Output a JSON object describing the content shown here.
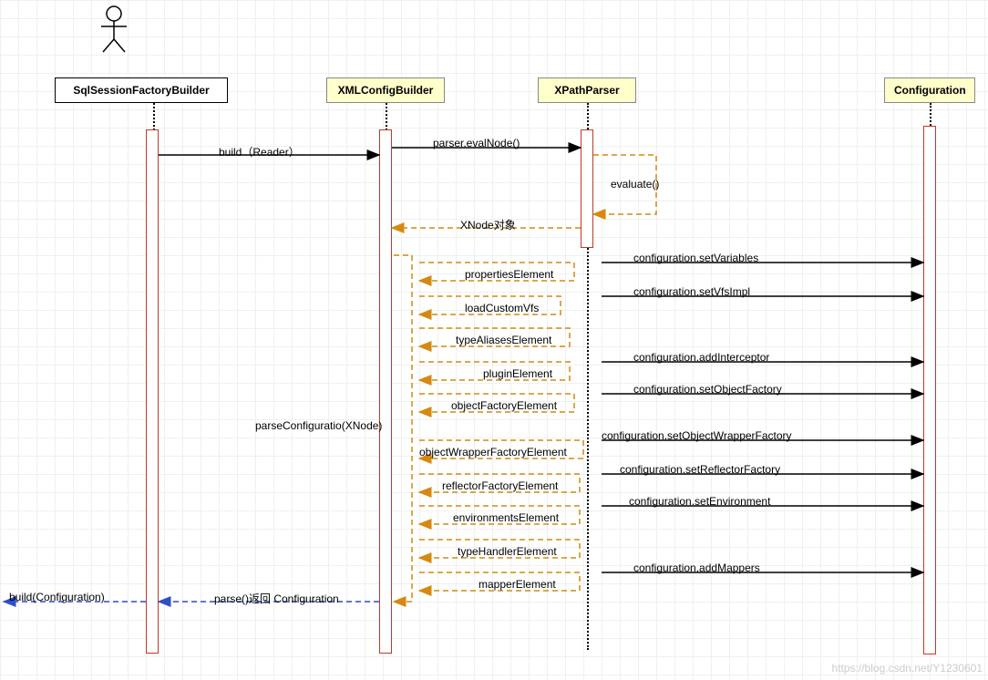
{
  "participants": {
    "p1": "SqlSessionFactoryBuilder",
    "p2": "XMLConfigBuilder",
    "p3": "XPathParser",
    "p4": "Configuration"
  },
  "messages": {
    "build_reader": "build（Reader）",
    "evalNode": "parser.evalNode()",
    "evaluate": "evaluate()",
    "xnode_return": "XNode对象",
    "parseConfiguration": "parseConfiguratio(XNode)",
    "propertiesElement": "propertiesElement",
    "loadCustomVfs": "loadCustomVfs",
    "typeAliasesElement": "typeAliasesElement",
    "pluginElement": "pluginElement",
    "objectFactoryElement": "objectFactoryElement",
    "objectWrapperFactoryElement": "objectWrapperFactoryElement",
    "reflectorFactoryElement": "reflectorFactoryElement",
    "environmentsElement": "environmentsElement",
    "typeHandlerElement": "typeHandlerElement",
    "mapperElement": "mapperElement",
    "setVariables": "configuration.setVariables",
    "setVfsImpl": "configuration.setVfsImpl",
    "addInterceptor": "configuration.addInterceptor",
    "setObjectFactory": "configuration.setObjectFactory",
    "setObjectWrapperFactory": "configuration.setObjectWrapperFactory",
    "setReflectorFactory": "configuration.setReflectorFactory",
    "setEnvironment": "configuration.setEnvironment",
    "addMappers": "configuration.addMappers",
    "parse_return": "parse()返回 Configuration",
    "build_return": "build(Configuration)"
  },
  "watermark": "https://blog.csdn.net/Y1230601"
}
